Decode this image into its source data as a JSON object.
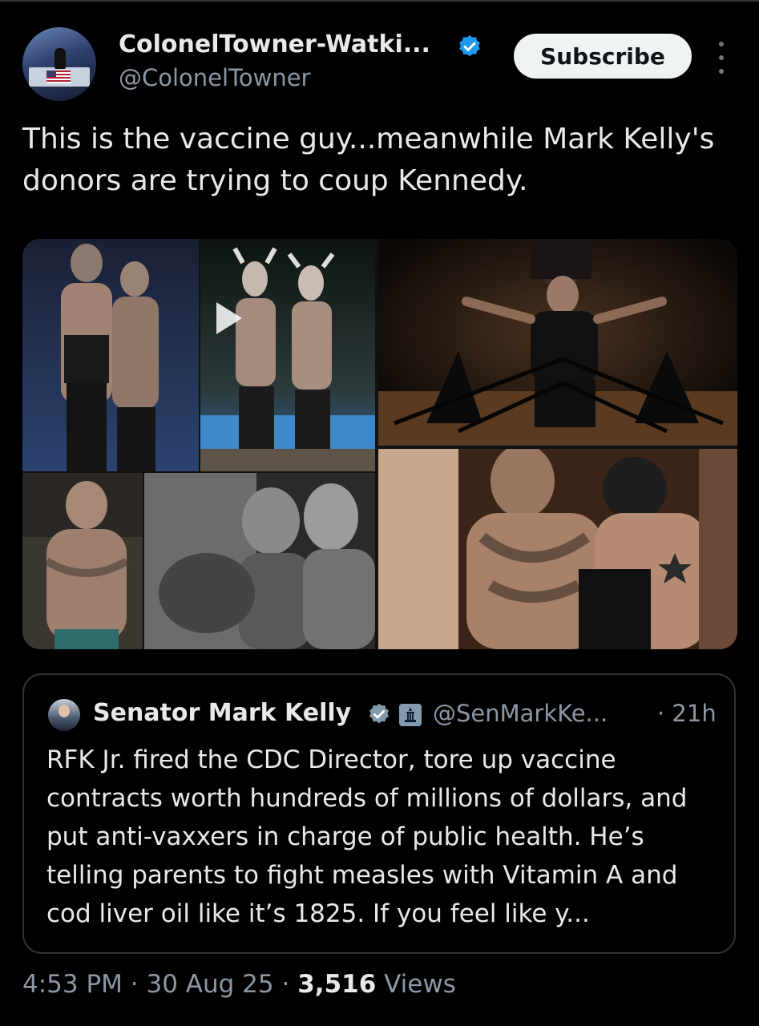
{
  "post": {
    "author_name": "ColonelTowner-Watki...",
    "author_handle": "@ColonelTowner",
    "subscribe_label": "Subscribe",
    "text": "This is the vaccine guy...meanwhile Mark Kelly's donors are trying to coup Kennedy."
  },
  "quoted": {
    "author_name": "Senator Mark Kelly",
    "author_handle": "@SenMarkKe...",
    "time": "· 21h",
    "text": "RFK Jr. fired the CDC Director, tore up vaccine contracts worth hundreds of millions of dollars, and put anti-vaxxers in charge of public health. He’s telling parents to fight measles with Vitamin A and cod liver oil like it’s 1825. If you feel like y..."
  },
  "meta": {
    "time": "4:53 PM",
    "date": "30 Aug 25",
    "views_count": "3,516",
    "views_label": "Views",
    "separator": "·"
  },
  "icons": [
    "verified-badge-icon",
    "more-options-icon",
    "play-icon",
    "government-badge-icon"
  ],
  "colors": {
    "background": "#000000",
    "text": "#e7e9ea",
    "secondary_text": "#8b98a5",
    "verified_blue": "#1d9bf0",
    "border": "#2f3336"
  }
}
